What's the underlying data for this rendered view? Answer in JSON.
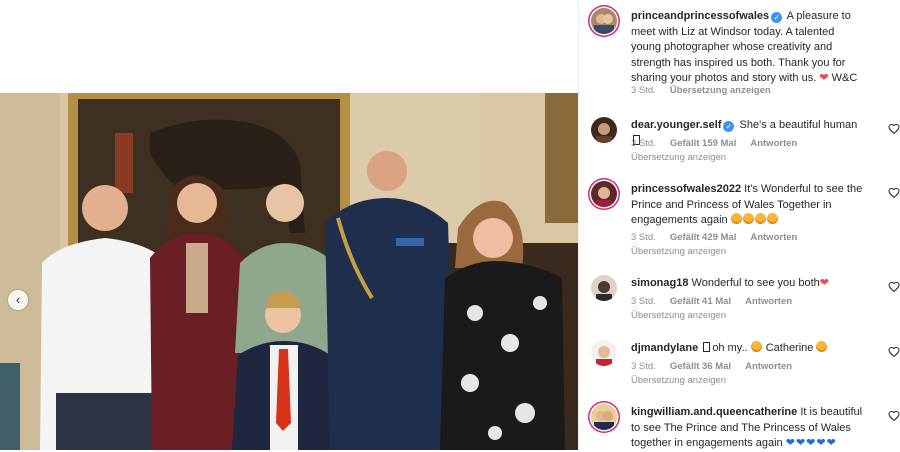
{
  "post": {
    "username": "princeandprincessofwales",
    "caption": "A pleasure to meet with Liz at Windsor today. A talented young photographer whose creativity and strength has inspired us both. Thank you for sharing your photos and story with us.",
    "signoff": "W&C",
    "time": "3 Std.",
    "translate": "Übersetzung anzeigen"
  },
  "comments": [
    {
      "username": "dear.younger.self",
      "verified": true,
      "text": "She's a beautiful human",
      "time": "3 Std.",
      "likes": "Gefällt 159 Mal",
      "reply": "Antworten",
      "translate": "Übersetzung anzeigen"
    },
    {
      "username": "princessofwales2022",
      "text": "It's Wonderful to see the Prince and Princess of Wales Together in engagements again",
      "time": "3 Std.",
      "likes": "Gefällt 429 Mal",
      "reply": "Antworten",
      "translate": "Übersetzung anzeigen"
    },
    {
      "username": "simonag18",
      "text": "Wonderful to see you both",
      "time": "3 Std.",
      "likes": "Gefällt 41 Mal",
      "reply": "Antworten",
      "translate": "Übersetzung anzeigen"
    },
    {
      "username": "djmandylane",
      "text_a": "oh my..",
      "text_b": "Catherine",
      "time": "3 Std.",
      "likes": "Gefällt 36 Mal",
      "reply": "Antworten",
      "translate": "Übersetzung anzeigen"
    },
    {
      "username": "kingwilliam.and.queencatherine",
      "text": "It is beautiful to see The Prince and The Princess of Wales together in engagements again"
    }
  ],
  "icons": {
    "prev": "chevron-left-icon",
    "like": "heart-outline-icon",
    "verified": "verified-badge-icon"
  },
  "colors": {
    "verified": "#3897f0",
    "red_heart": "#ed4956",
    "story_ring": "#d62976",
    "meta_text": "#8e8e8e"
  }
}
